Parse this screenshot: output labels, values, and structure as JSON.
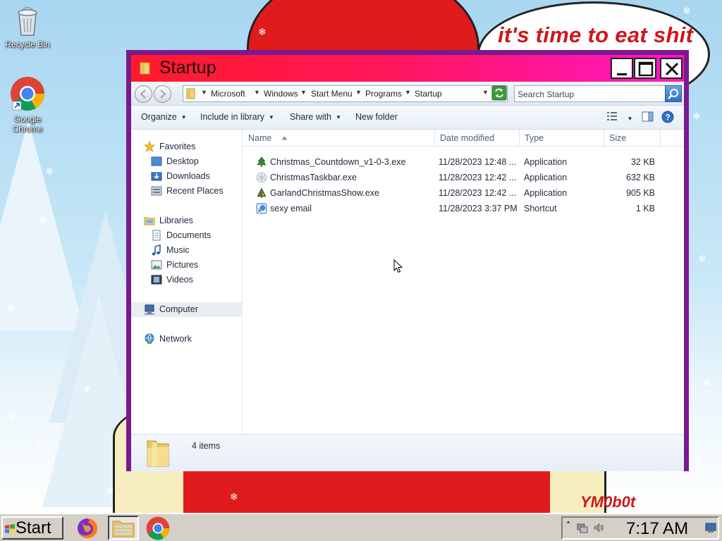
{
  "desktop": {
    "icons": [
      {
        "label": "Recycle Bin",
        "icon": "recycle-bin-icon"
      },
      {
        "label": "Google Chrome",
        "icon": "chrome-icon"
      }
    ],
    "wallpaper_caption": "it's time to eat shit",
    "wallpaper_signature": "YM0b0t"
  },
  "window": {
    "title": "Startup",
    "controls": {
      "minimize": "minimize-icon",
      "maximize": "maximize-icon",
      "close": "close-icon"
    },
    "address": {
      "crumbs": [
        "Microsoft",
        "Windows",
        "Start Menu",
        "Programs",
        "Startup"
      ]
    },
    "search": {
      "placeholder": "Search Startup"
    },
    "toolbar": {
      "organize": "Organize",
      "include_in_library": "Include in library",
      "share_with": "Share with",
      "new_folder": "New folder"
    },
    "nav": {
      "favorites": "Favorites",
      "desktop": "Desktop",
      "downloads": "Downloads",
      "recent_places": "Recent Places",
      "libraries": "Libraries",
      "documents": "Documents",
      "music": "Music",
      "pictures": "Pictures",
      "videos": "Videos",
      "computer": "Computer",
      "network": "Network"
    },
    "columns": {
      "name": "Name",
      "date_modified": "Date modified",
      "type": "Type",
      "size": "Size"
    },
    "files": [
      {
        "name": "Christmas_Countdown_v1-0-3.exe",
        "date": "11/28/2023 12:48 ...",
        "type": "Application",
        "size": "32 KB",
        "icon": "christmas-tree-icon"
      },
      {
        "name": "ChristmasTaskbar.exe",
        "date": "11/28/2023 12:42 ...",
        "type": "Application",
        "size": "632 KB",
        "icon": "snowflake-icon"
      },
      {
        "name": "GarlandChristmasShow.exe",
        "date": "11/28/2023 12:42 ...",
        "type": "Application",
        "size": "905 KB",
        "icon": "garland-tree-icon"
      },
      {
        "name": "sexy email",
        "date": "11/28/2023 3:37 PM",
        "type": "Shortcut",
        "size": "1 KB",
        "icon": "shortcut-icon"
      }
    ],
    "status": {
      "item_count": "4 items"
    }
  },
  "taskbar": {
    "start_label": "Start",
    "apps": [
      {
        "name": "Firefox",
        "icon": "firefox-icon"
      },
      {
        "name": "File Explorer",
        "icon": "file-explorer-icon"
      },
      {
        "name": "Google Chrome",
        "icon": "chrome-icon"
      }
    ],
    "clock": "7:17 AM"
  },
  "colors": {
    "window_border": "#7a1a8f",
    "title_gradient_start": "#ff1b2a",
    "title_gradient_end": "#ff16c8",
    "caption_red": "#d0151c"
  }
}
